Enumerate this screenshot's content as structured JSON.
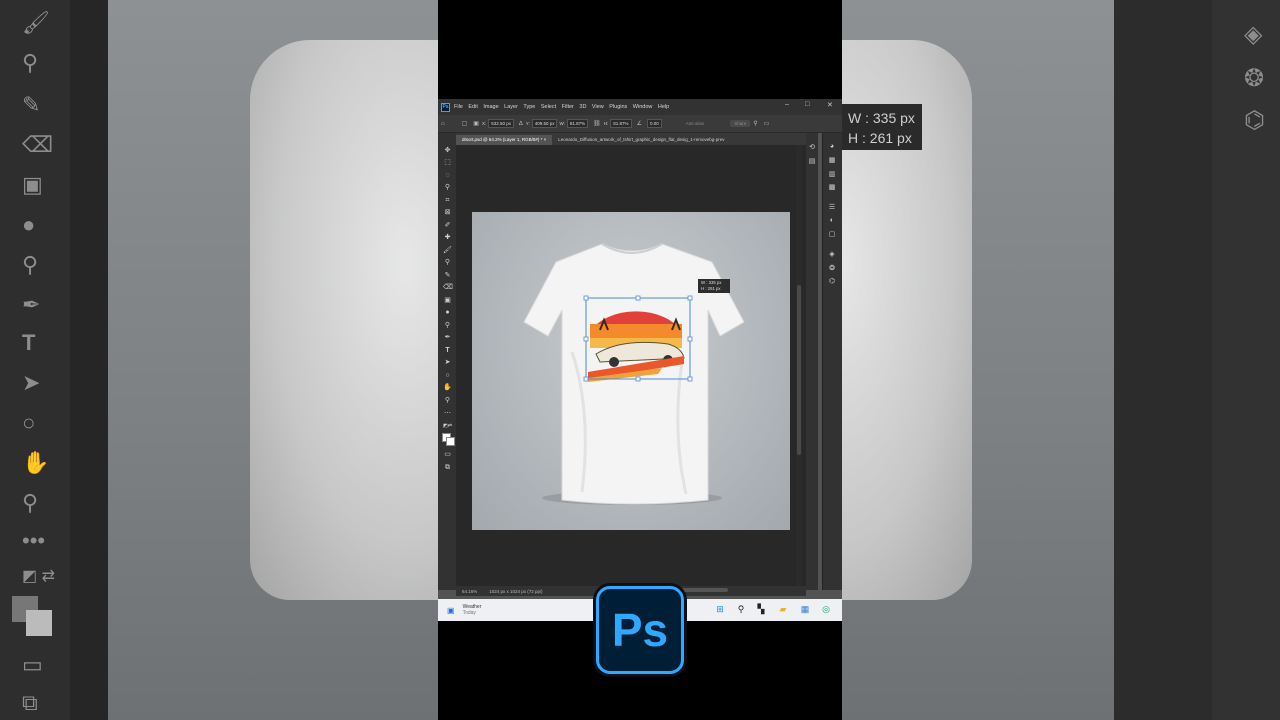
{
  "app": {
    "name": "Adobe Photoshop",
    "logo_text": "Ps"
  },
  "menu": {
    "items": [
      "File",
      "Edit",
      "Image",
      "Layer",
      "Type",
      "Select",
      "Filter",
      "3D",
      "View",
      "Plugins",
      "Window",
      "Help"
    ]
  },
  "window_controls": {
    "minimize": "–",
    "maximize": "□",
    "close": "✕"
  },
  "options": {
    "x_label": "X:",
    "x_value": "532.50 px",
    "y_label": "Y:",
    "y_value": "409.50 px",
    "w_label": "W:",
    "w_value": "81.87%",
    "h_label": "H:",
    "h_value": "81.87%",
    "angle_value": "0.00",
    "interpolation": "Bicubic",
    "antialias": "Anti-alias",
    "share": "Share"
  },
  "tabs": [
    {
      "label": "dtsort.psd @ 64.2% (Layer 1, RGB/8#) *",
      "close": "×"
    },
    {
      "label": "Leonardo_Diffusion_artwork_of_tshirt_graphic_design_flat_desig_1-removebg-prev",
      "close": ""
    }
  ],
  "canvas": {
    "tooltip_w": "W : 335 px",
    "tooltip_h": "H : 261 px"
  },
  "status": {
    "zoom": "64.16%",
    "doc_size": "1024 px x 1024 px (72 ppi)"
  },
  "taskbar": {
    "weather_title": "Weather",
    "weather_sub": "Today"
  },
  "background_tooltip": {
    "w": "W : 335 px",
    "h": "H : 261 px"
  },
  "colors": {
    "ps_blue": "#31a8ff",
    "ps_dark": "#001e36",
    "selection": "#4a8bd8"
  }
}
